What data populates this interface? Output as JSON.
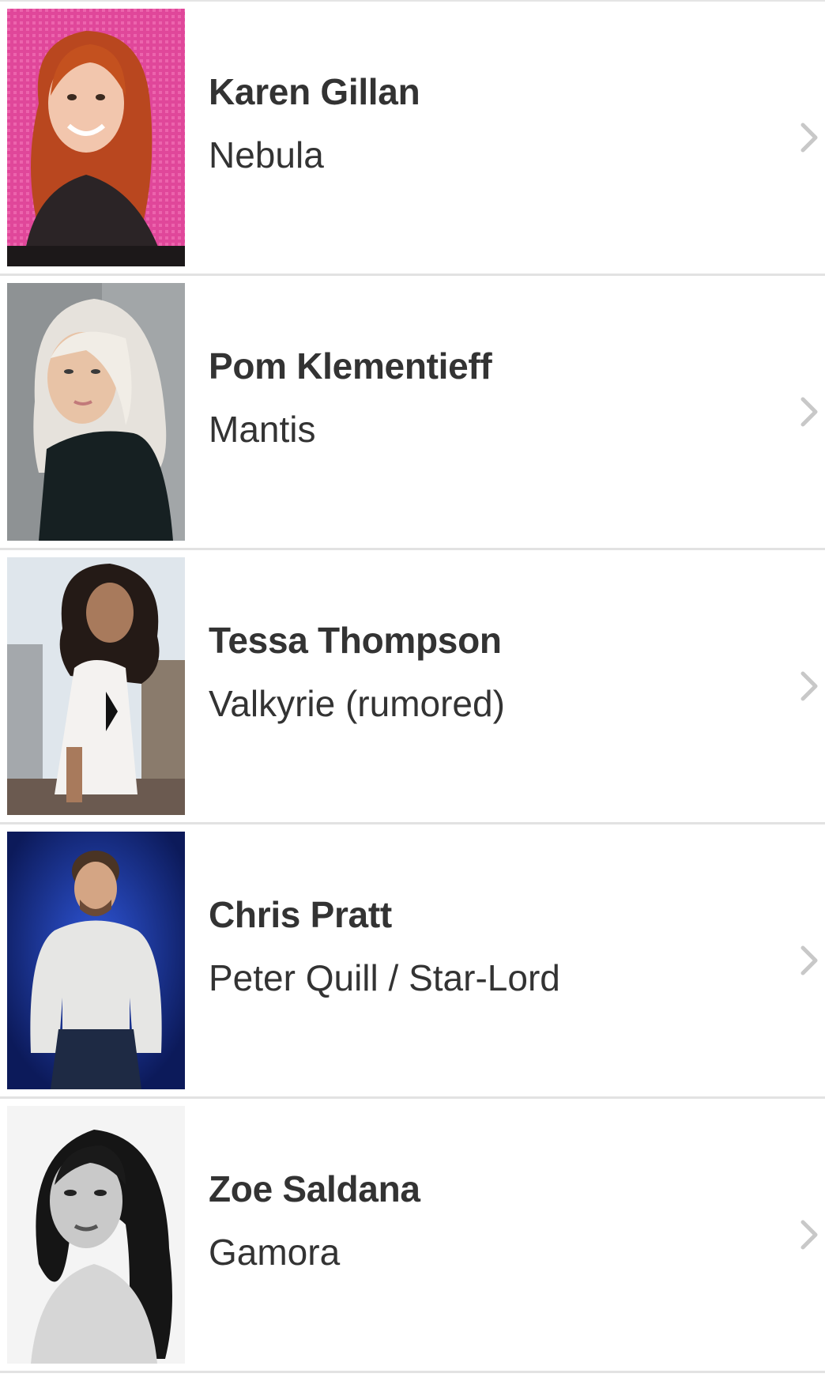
{
  "cast": [
    {
      "actor": "Karen Gillan",
      "role": "Nebula"
    },
    {
      "actor": "Pom Klementieff",
      "role": "Mantis"
    },
    {
      "actor": "Tessa Thompson",
      "role": "Valkyrie (rumored)"
    },
    {
      "actor": "Chris Pratt",
      "role": "Peter Quill / Star-Lord"
    },
    {
      "actor": "Zoe Saldana",
      "role": "Gamora"
    }
  ],
  "colors": {
    "text": "#333333",
    "divider": "#e2e2e2",
    "chevron": "#c8c8c8"
  },
  "icons": {
    "row_action": "chevron-right-icon"
  }
}
